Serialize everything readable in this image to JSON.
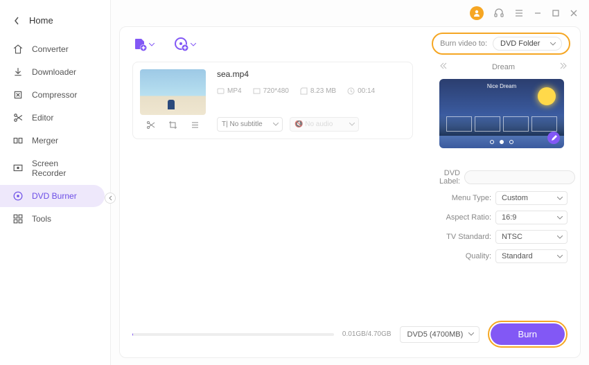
{
  "sidebar": {
    "home": "Home",
    "items": [
      "Converter",
      "Downloader",
      "Compressor",
      "Editor",
      "Merger",
      "Screen Recorder",
      "DVD Burner",
      "Tools"
    ],
    "active_index": 6
  },
  "burn_to": {
    "label": "Burn video to:",
    "value": "DVD Folder"
  },
  "file": {
    "name": "sea.mp4",
    "format": "MP4",
    "resolution": "720*480",
    "size": "8.23 MB",
    "duration": "00:14",
    "subtitle": "No subtitle",
    "audio": "No audio"
  },
  "template": {
    "name": "Dream",
    "preview_title": "Nice Dream"
  },
  "form": {
    "labels": {
      "dvd_label": "DVD Label:",
      "menu_type": "Menu Type:",
      "aspect_ratio": "Aspect Ratio:",
      "tv_standard": "TV Standard:",
      "quality": "Quality:"
    },
    "menu_type": "Custom",
    "aspect_ratio": "16:9",
    "tv_standard": "NTSC",
    "quality": "Standard",
    "dvd_label": ""
  },
  "footer": {
    "progress": "0.01GB/4.70GB",
    "disc": "DVD5 (4700MB)",
    "burn": "Burn"
  }
}
